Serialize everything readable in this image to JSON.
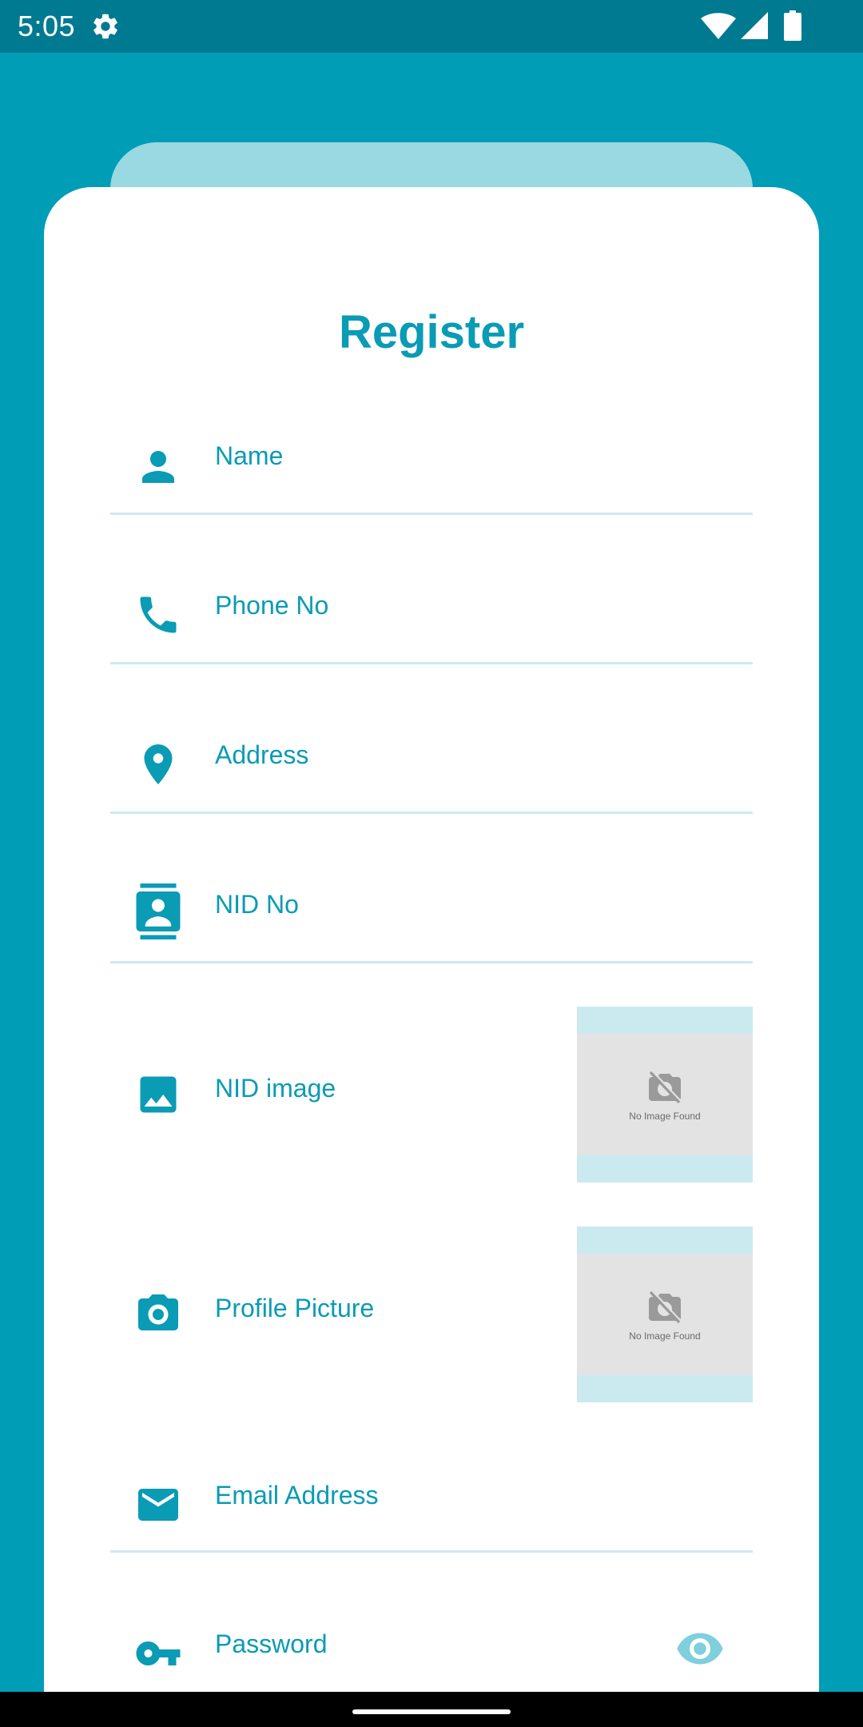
{
  "status_bar": {
    "time": "5:05",
    "icons": [
      "gear-icon",
      "wifi-icon",
      "signal-icon",
      "battery-icon"
    ]
  },
  "colors": {
    "primary": "#009DB7",
    "status_bar": "#007A90",
    "accent_text": "#0A9BB5",
    "back_card": "#9AD8E2",
    "underline": "#CDEAEF"
  },
  "form": {
    "title": "Register",
    "fields": [
      {
        "icon": "person-icon",
        "label": "Name"
      },
      {
        "icon": "phone-icon",
        "label": "Phone No"
      },
      {
        "icon": "location-pin-icon",
        "label": "Address"
      },
      {
        "icon": "id-card-icon",
        "label": "NID No"
      },
      {
        "icon": "image-icon",
        "label": "NID image",
        "preview_text": "No Image Found"
      },
      {
        "icon": "camera-icon",
        "label": "Profile Picture",
        "preview_text": "No Image Found"
      },
      {
        "icon": "email-icon",
        "label": "Email Address"
      },
      {
        "icon": "key-icon",
        "label": "Password",
        "trailing_icon": "eye-icon"
      }
    ]
  }
}
